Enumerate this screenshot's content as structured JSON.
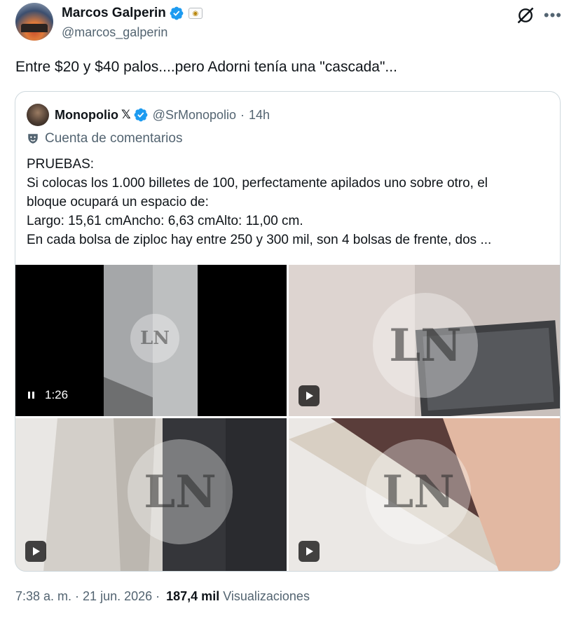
{
  "tweet": {
    "author_name": "Marcos Galperin",
    "author_handle": "@marcos_galperin",
    "text": "Entre $20 y $40 palos....pero Adorni tenía una \"cascada\"...",
    "time": "7:38 a. m.",
    "date": "21 jun. 2026",
    "views_count": "187,4 mil",
    "views_label": "Visualizaciones"
  },
  "quote": {
    "author_name": "Monopolio",
    "x_mark": "𝕏",
    "author_handle": "@SrMonopolio",
    "separator": "·",
    "time": "14h",
    "label": "Cuenta de comentarios",
    "lines": [
      "PRUEBAS:",
      "Si colocas los 1.000 billetes de 100, perfectamente apilados uno sobre otro, el",
      "bloque ocupará un espacio de:",
      "Largo: 15,61 cmAncho: 6,63 cmAlto: 11,00 cm.",
      "En cada bolsa de ziploc hay entre 250 y 300 mil, son 4 bolsas de frente, dos ..."
    ],
    "media": {
      "video_duration": "1:26",
      "watermark": "LN"
    }
  },
  "icons": {
    "verified": "verified-badge-icon",
    "affiliate": "affiliate-badge-icon",
    "grok": "grok-icon",
    "more": "more-icon",
    "parody": "mask-icon",
    "play": "play-icon",
    "pause": "pause-icon"
  },
  "colors": {
    "text": "#0f1419",
    "secondary": "#536471",
    "verified": "#1d9bf0",
    "border": "#cfd9de"
  }
}
